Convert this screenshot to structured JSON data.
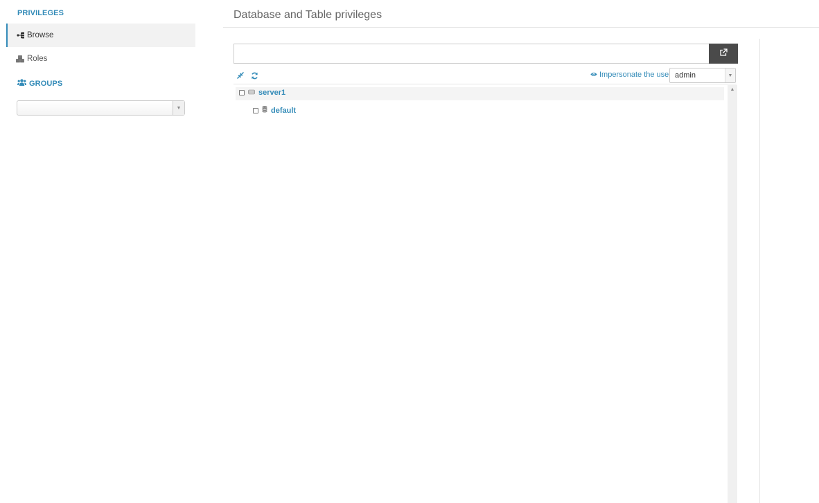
{
  "sidebar": {
    "privileges_title": "PRIVILEGES",
    "items": [
      {
        "label": "Browse",
        "icon": "sitemap-icon",
        "active": true
      },
      {
        "label": "Roles",
        "icon": "cubes-icon",
        "active": false
      }
    ],
    "groups_title": "GROUPS",
    "groups_icon": "users-icon",
    "group_select_value": ""
  },
  "main": {
    "title": "Database and Table privileges",
    "search": {
      "value": "",
      "placeholder": "",
      "button_icon": "external-link-icon"
    },
    "toolbar": {
      "collapse_icon": "compress-icon",
      "refresh_icon": "refresh-icon",
      "impersonate_label": "Impersonate the user",
      "impersonate_icon": "eye-icon",
      "user_select_value": "admin"
    },
    "tree": [
      {
        "label": "server1",
        "icon": "server-icon",
        "level": 0,
        "checked": false
      },
      {
        "label": "default",
        "icon": "database-icon",
        "level": 1,
        "checked": false
      }
    ]
  },
  "colors": {
    "accent": "#338bb8",
    "button_dark": "#4a4a4a",
    "active_bg": "#f2f2f2"
  }
}
